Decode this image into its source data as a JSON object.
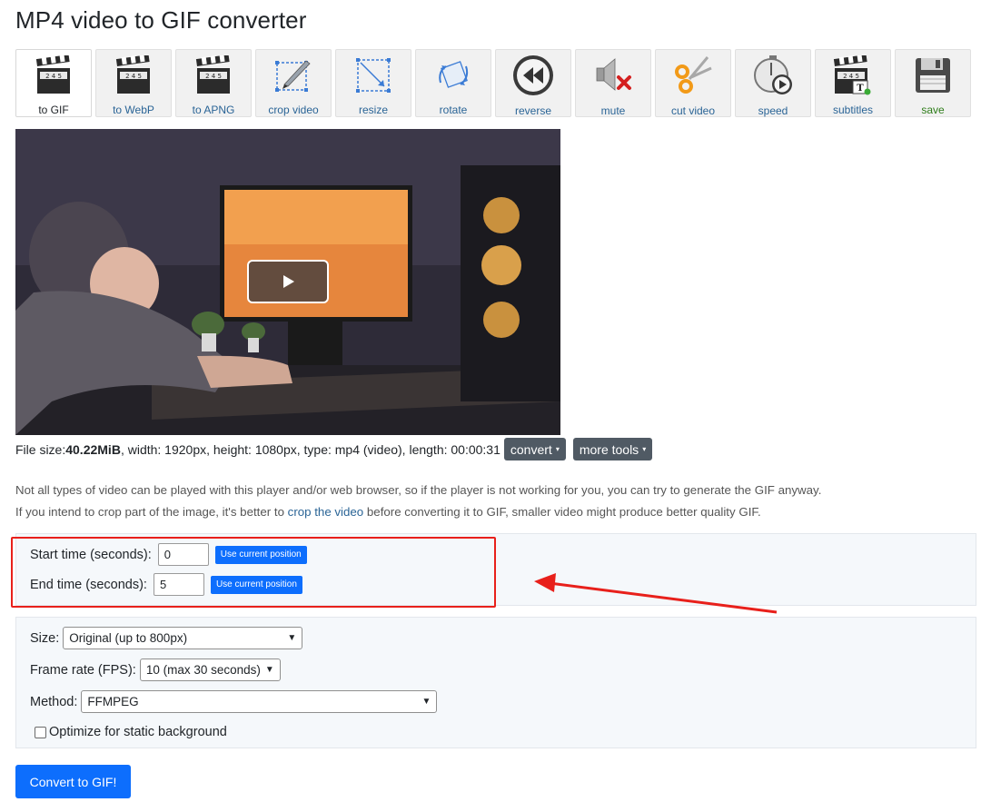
{
  "page": {
    "title": "MP4 video to GIF converter"
  },
  "toolbar": [
    {
      "label": "to GIF",
      "icon": "clapperboard-icon",
      "active": true
    },
    {
      "label": "to WebP",
      "icon": "clapperboard-icon"
    },
    {
      "label": "to APNG",
      "icon": "clapperboard-icon"
    },
    {
      "label": "crop video",
      "icon": "crop-icon"
    },
    {
      "label": "resize",
      "icon": "resize-icon"
    },
    {
      "label": "rotate",
      "icon": "rotate-icon"
    },
    {
      "label": "reverse",
      "icon": "rewind-icon"
    },
    {
      "label": "mute",
      "icon": "mute-icon"
    },
    {
      "label": "cut video",
      "icon": "scissors-icon"
    },
    {
      "label": "speed",
      "icon": "stopwatch-icon"
    },
    {
      "label": "subtitles",
      "icon": "subtitles-icon"
    },
    {
      "label": "save",
      "icon": "floppy-disk-icon"
    }
  ],
  "clapper_digits": "2 4 5",
  "subtitle_badge": "T",
  "video": {
    "play_icon": "play-icon"
  },
  "file_info": {
    "size_prefix": "File size: ",
    "size": "40.22MiB",
    "details": ", width: 1920px, height: 1080px, type: mp4 (video), length: 00:00:31"
  },
  "buttons": {
    "convert": "convert",
    "more_tools": "more tools",
    "caret": "▾"
  },
  "notes": {
    "line1": "Not all types of video can be played with this player and/or web browser, so if the player is not working for you, you can try to generate the GIF anyway.",
    "line2_before": "If you intend to crop part of the image, it's better to ",
    "line2_link": "crop the video",
    "line2_after": " before converting it to GIF, smaller video might produce better quality GIF."
  },
  "time": {
    "start_label": "Start time (seconds):",
    "start_value": "0",
    "end_label": "End time (seconds):",
    "end_value": "5",
    "use_position": "Use current position"
  },
  "options": {
    "size_label": "Size:",
    "size_value": "Original (up to 800px)",
    "fps_label": "Frame rate (FPS):",
    "fps_value": "10 (max 30 seconds)",
    "method_label": "Method:",
    "method_value": "FFMPEG",
    "optimize_label": "Optimize for static background",
    "optimize_checked": false
  },
  "submit": "Convert to GIF!",
  "colors": {
    "accent": "#0d6efd",
    "annotation": "#e8201b",
    "link": "#2a6496"
  }
}
